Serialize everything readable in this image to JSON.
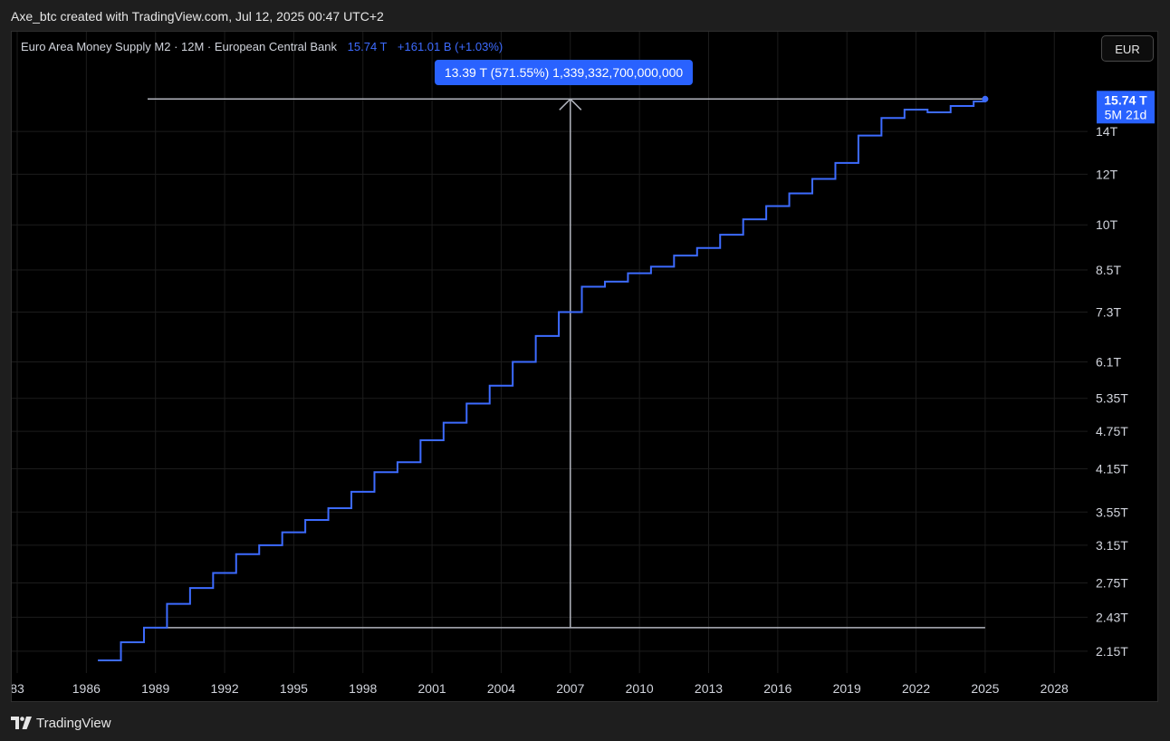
{
  "header": {
    "caption": "Axe_btc created with TradingView.com, Jul 12, 2025 00:47 UTC+2"
  },
  "legend": {
    "title": "Euro Area Money Supply M2 · 12M · European Central Bank",
    "value": "15.74 T",
    "change": "+161.01 B (+1.03%)"
  },
  "currency_button": "EUR",
  "measure_tooltip": "13.39 T (571.55%) 1,339,332,700,000,000",
  "price_badge": {
    "value": "15.74 T",
    "countdown": "5M 21d"
  },
  "footer": {
    "brand": "TradingView",
    "logo_icon": "tradingview-logo-icon"
  },
  "colors": {
    "series": "#3d6bff",
    "badge": "#2962ff",
    "grid": "#1c1c1c",
    "measure": "#b2b5be"
  },
  "chart_data": {
    "type": "line",
    "style": "step",
    "scale": "log",
    "grid": true,
    "ylim": [
      2.0,
      16.6
    ],
    "xlim": [
      1983,
      2031
    ],
    "x_ticks": [
      "83",
      "1986",
      "1989",
      "1992",
      "1995",
      "1998",
      "2001",
      "2004",
      "2007",
      "2010",
      "2013",
      "2016",
      "2019",
      "2022",
      "2025",
      "2028"
    ],
    "x_tick_values": [
      1983,
      1986,
      1989,
      1992,
      1995,
      1998,
      2001,
      2004,
      2007,
      2010,
      2013,
      2016,
      2019,
      2022,
      2025,
      2028
    ],
    "y_ticks": [
      "14T",
      "12T",
      "10T",
      "8.5T",
      "7.3T",
      "6.1T",
      "5.35T",
      "4.75T",
      "4.15T",
      "3.55T",
      "3.15T",
      "2.75T",
      "2.43T",
      "2.15T"
    ],
    "y_tick_values": [
      14,
      12,
      10,
      8.5,
      7.3,
      6.1,
      5.35,
      4.75,
      4.15,
      3.55,
      3.15,
      2.75,
      2.43,
      2.15
    ],
    "series": [
      {
        "name": "Euro Area Money Supply M2",
        "x": [
          1986.5,
          1987.5,
          1988.5,
          1989.5,
          1990.5,
          1991.5,
          1992.5,
          1993.5,
          1994.5,
          1995.5,
          1996.5,
          1997.5,
          1998.5,
          1999.5,
          2000.5,
          2001.5,
          2002.5,
          2003.5,
          2004.5,
          2005.5,
          2006.5,
          2007.5,
          2008.5,
          2009.5,
          2010.5,
          2011.5,
          2012.5,
          2013.5,
          2014.5,
          2015.5,
          2016.5,
          2017.5,
          2018.5,
          2019.5,
          2020.5,
          2021.5,
          2022.5,
          2023.5,
          2024.5,
          2025.0
        ],
        "y": [
          2.08,
          2.22,
          2.34,
          2.55,
          2.7,
          2.85,
          3.05,
          3.15,
          3.3,
          3.45,
          3.6,
          3.82,
          4.1,
          4.25,
          4.6,
          4.9,
          5.25,
          5.6,
          6.1,
          6.7,
          7.3,
          8.0,
          8.15,
          8.4,
          8.6,
          8.95,
          9.2,
          9.65,
          10.2,
          10.7,
          11.2,
          11.8,
          12.5,
          13.8,
          14.7,
          15.15,
          15.0,
          15.35,
          15.6,
          15.74
        ]
      }
    ],
    "measurement": {
      "from": {
        "x": 1989.5,
        "y": 2.34
      },
      "to": {
        "x": 2025.0,
        "y": 15.74
      },
      "x_at": 2007.0
    }
  }
}
